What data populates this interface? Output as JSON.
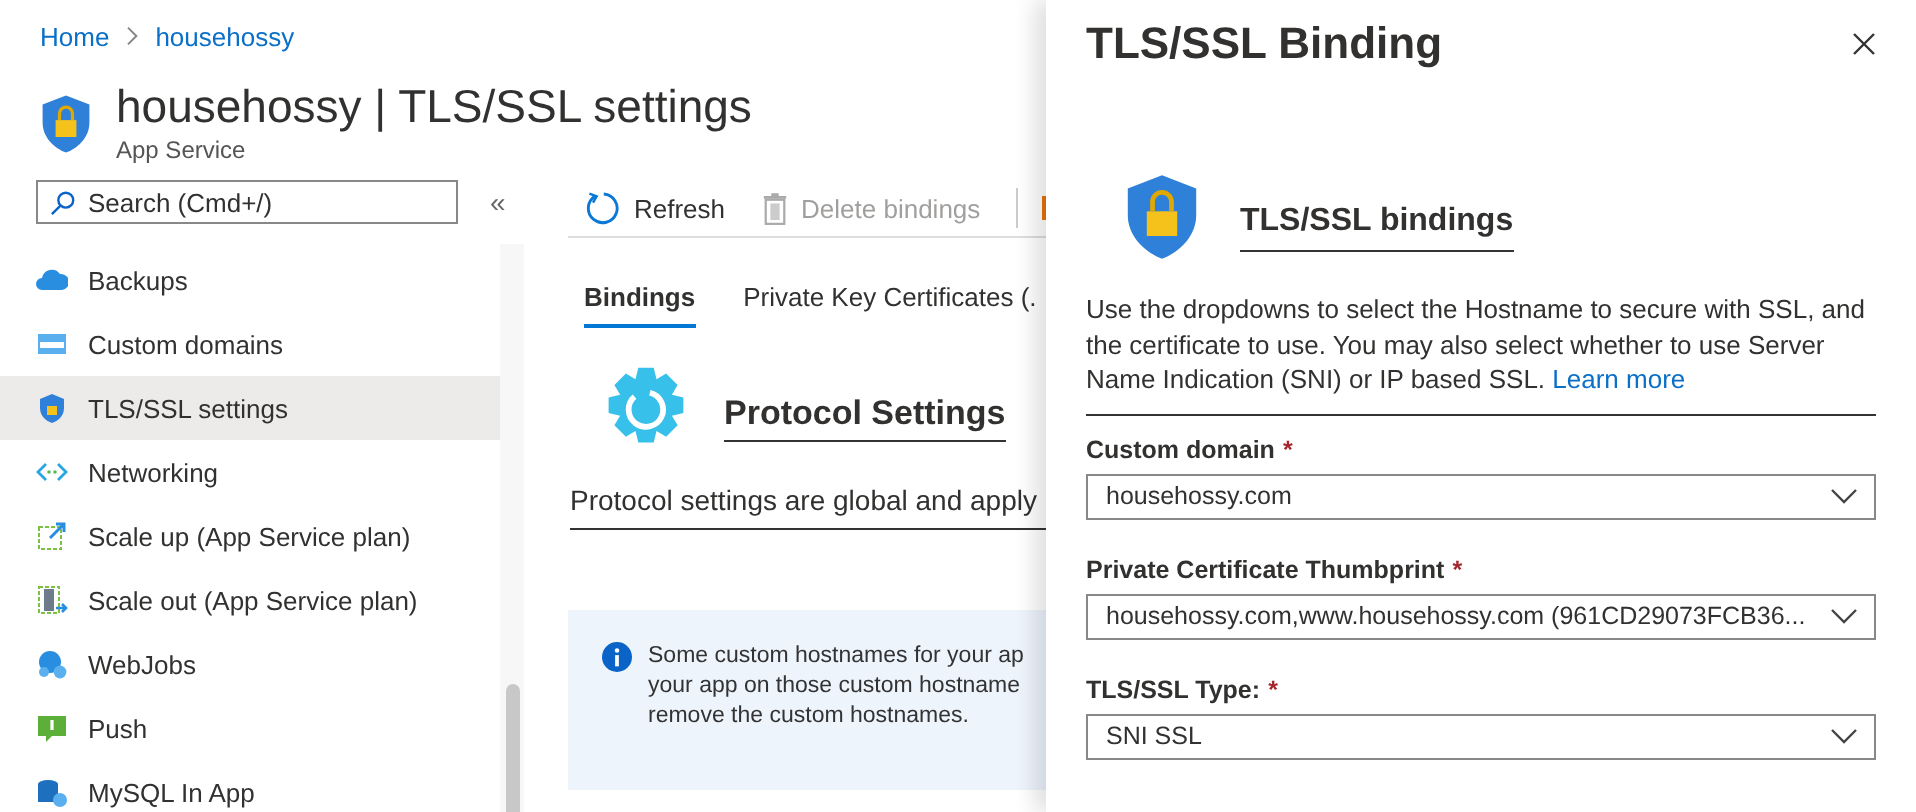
{
  "breadcrumb": [
    {
      "label": "Home"
    },
    {
      "label": "househossy"
    }
  ],
  "page": {
    "title": "househossy | TLS/SSL settings",
    "subtitle": "App Service"
  },
  "search": {
    "placeholder": "Search (Cmd+/)"
  },
  "collapse": "«",
  "sidebar": {
    "items": [
      {
        "label": "Backups",
        "selected": false
      },
      {
        "label": "Custom domains",
        "selected": false
      },
      {
        "label": "TLS/SSL settings",
        "selected": true
      },
      {
        "label": "Networking",
        "selected": false
      },
      {
        "label": "Scale up (App Service plan)",
        "selected": false
      },
      {
        "label": "Scale out (App Service plan)",
        "selected": false
      },
      {
        "label": "WebJobs",
        "selected": false
      },
      {
        "label": "Push",
        "selected": false
      },
      {
        "label": "MySQL In App",
        "selected": false
      }
    ]
  },
  "toolbar": [
    {
      "label": "Refresh",
      "disabled": false
    },
    {
      "label": "Delete bindings",
      "disabled": true
    }
  ],
  "tabs": [
    {
      "label": "Bindings",
      "selected": true
    },
    {
      "label": "Private Key Certificates (.",
      "selected": false
    }
  ],
  "protocol": {
    "heading": "Protocol Settings",
    "text": "Protocol settings are global and apply"
  },
  "info": {
    "lines": [
      "Some custom hostnames for your ap",
      "your app on those custom hostname",
      "remove the custom hostnames."
    ]
  },
  "panel": {
    "title": "TLS/SSL Binding",
    "required_mark": "*",
    "section": "TLS/SSL bindings",
    "description": "Use the dropdowns to select the Hostname to secure with SSL, and the certificate to use. You may also select whether to use Server Name Indication (SNI) or IP based SSL.",
    "link": "Learn more",
    "fields": [
      {
        "label": "Custom domain",
        "required": true,
        "value": "househossy.com"
      },
      {
        "label": "Private Certificate Thumbprint",
        "required": true,
        "value": "househossy.com,www.househossy.com (961CD29073FCB36..."
      },
      {
        "label": "TLS/SSL Type:",
        "required": true,
        "value": "SNI SSL"
      }
    ]
  }
}
